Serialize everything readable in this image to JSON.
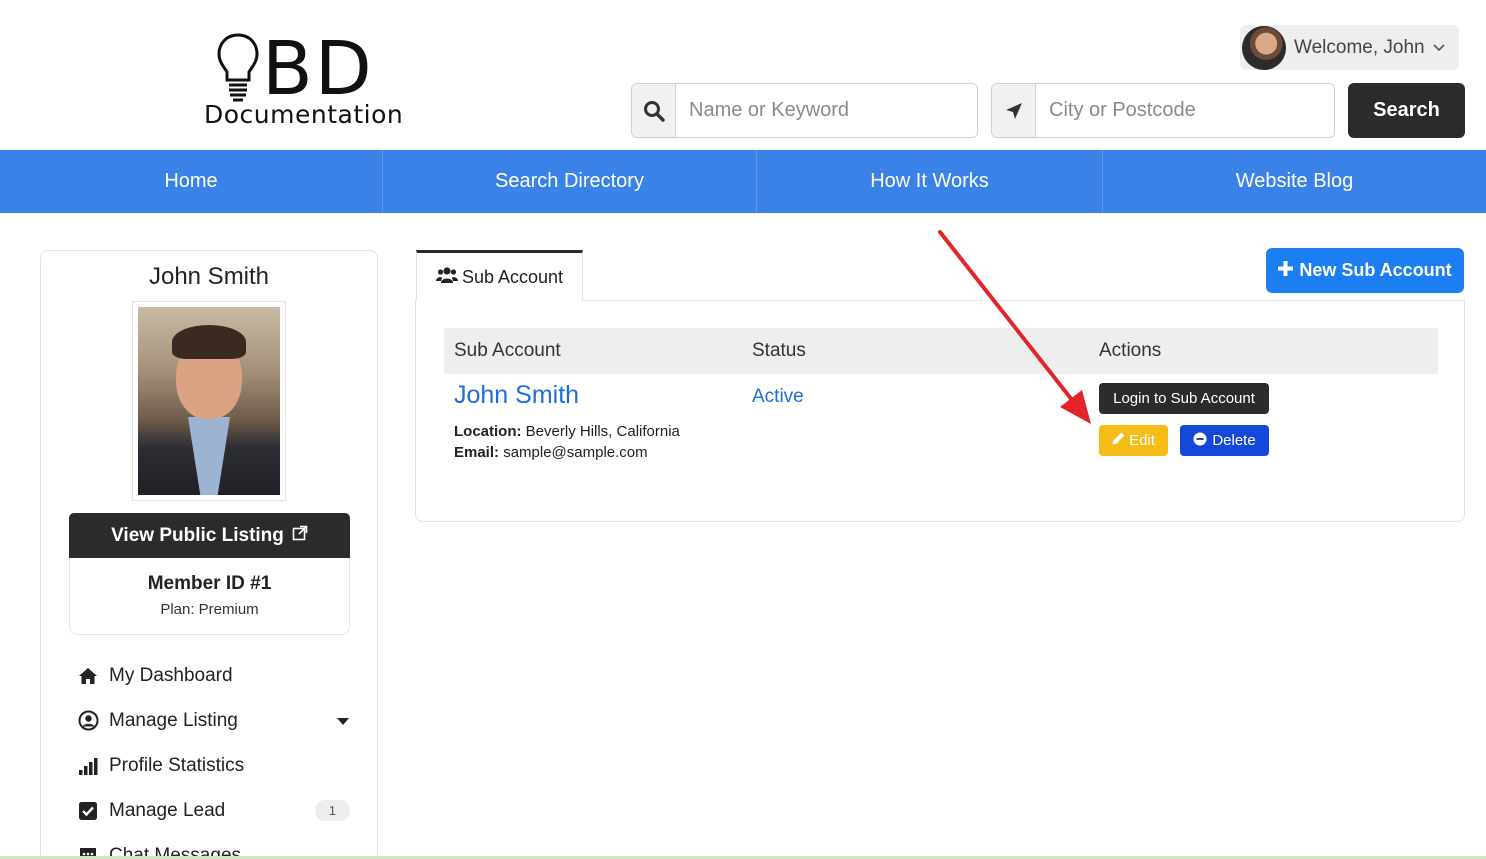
{
  "header": {
    "logo": {
      "main": "BD",
      "sub": "Documentation"
    },
    "welcome": "Welcome, John",
    "search": {
      "keyword_placeholder": "Name or Keyword",
      "location_placeholder": "City or Postcode",
      "button_label": "Search"
    }
  },
  "nav": {
    "items": [
      {
        "label": "Home"
      },
      {
        "label": "Search Directory"
      },
      {
        "label": "How It Works"
      },
      {
        "label": "Website Blog"
      }
    ]
  },
  "sidebar": {
    "name": "John Smith",
    "view_listing_label": "View Public Listing",
    "member_id": "Member ID #1",
    "plan": "Plan: Premium",
    "menu": [
      {
        "label": "My Dashboard",
        "icon": "home-icon"
      },
      {
        "label": "Manage Listing",
        "icon": "user-circle-icon"
      },
      {
        "label": "Profile Statistics",
        "icon": "bar-chart-icon"
      },
      {
        "label": "Manage Lead",
        "icon": "checkbox-icon",
        "badge": "1"
      },
      {
        "label": "Chat Messages",
        "icon": "chat-icon"
      }
    ]
  },
  "main": {
    "tab_label": "Sub Account",
    "new_button_label": "New Sub Account",
    "table": {
      "columns": [
        "Sub Account",
        "Status",
        "Actions"
      ],
      "rows": [
        {
          "name": "John Smith",
          "status": "Active",
          "location_label": "Location:",
          "location": "Beverly Hills, California",
          "email_label": "Email:",
          "email": "sample@sample.com",
          "actions": {
            "login": "Login to Sub Account",
            "edit": "Edit",
            "delete": "Delete"
          }
        }
      ]
    }
  },
  "colors": {
    "nav_bg": "#3b82e8",
    "primary_button": "#1c7ef0",
    "edit_button": "#f5bb16",
    "delete_button": "#1448d8",
    "dark_button": "#2b2b2b",
    "link": "#1c6fd8",
    "annotation_arrow": "#e4232b"
  }
}
